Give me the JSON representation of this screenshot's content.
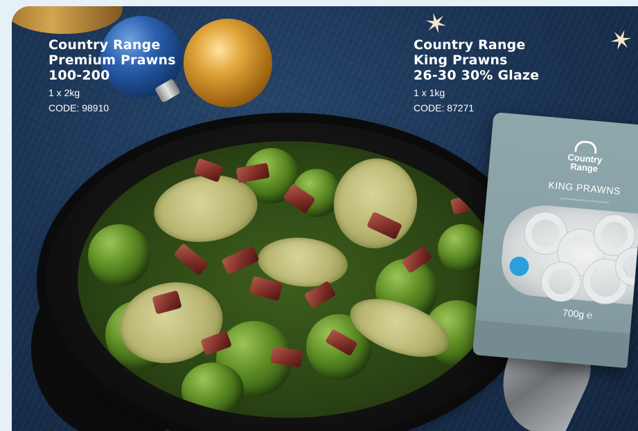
{
  "products": [
    {
      "title_lines": [
        "Country Range",
        "Premium Prawns",
        "100-200"
      ],
      "pack": "1 x 2kg",
      "code": "CODE: 98910"
    },
    {
      "title_lines": [
        "Country Range",
        "King Prawns",
        "26-30 30% Glaze"
      ],
      "pack": "1 x 1kg",
      "code": "CODE: 87271"
    }
  ],
  "packet": {
    "brand_lines": [
      "Country",
      "Range"
    ],
    "product_name": "KING PRAWNS",
    "weight": "700g ℮"
  },
  "colors": {
    "page_background": "#e6f1f7",
    "photo_background": "#1b3556",
    "label_text": "#ffffff",
    "packet": "#8ea7ab"
  }
}
